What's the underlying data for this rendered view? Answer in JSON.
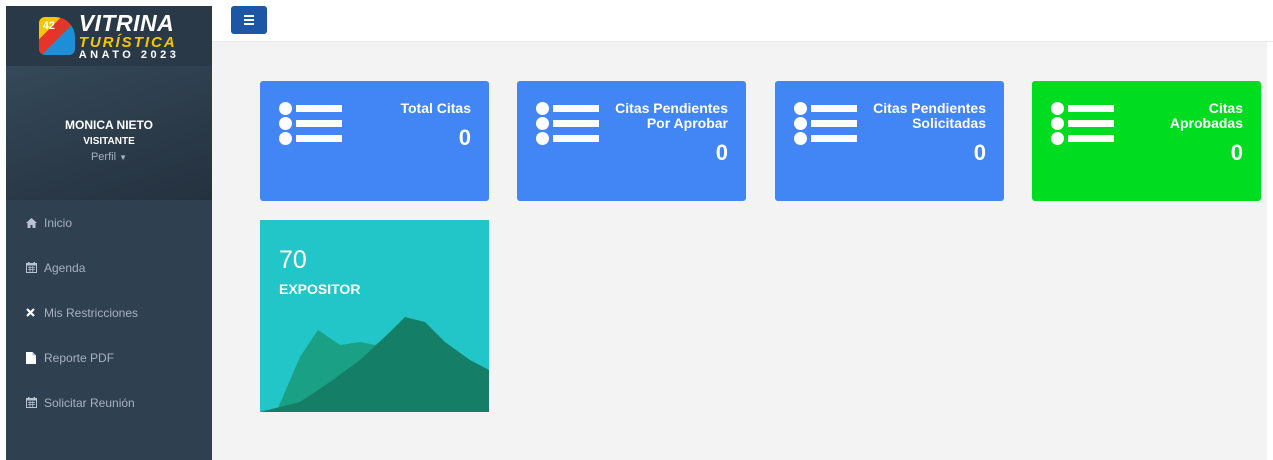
{
  "logo": {
    "number": "42",
    "line1": "VITRINA",
    "line2": "TURÍSTICA",
    "line3": "ANATO 2023"
  },
  "profile": {
    "name": "MONICA NIETO",
    "role": "VISITANTE",
    "link": "Perfil",
    "link_icon": "caret-down-icon"
  },
  "menu": [
    {
      "label": "Inicio",
      "icon": "home-icon"
    },
    {
      "label": "Agenda",
      "icon": "calendar-icon"
    },
    {
      "label": "Mis Restricciones",
      "icon": "close-icon"
    },
    {
      "label": "Reporte PDF",
      "icon": "file-icon"
    },
    {
      "label": "Solicitar Reunión",
      "icon": "calendar-icon"
    }
  ],
  "topbar": {
    "toggle_icon": "hamburger-icon",
    "toggle_color": "#1c56a4"
  },
  "cards": [
    {
      "title": "Total Citas",
      "value": "0",
      "icon": "list-icon",
      "color": "#4285f4"
    },
    {
      "title": "Citas Pendientes Por Aprobar",
      "value": "0",
      "icon": "list-icon",
      "color": "#4285f4"
    },
    {
      "title": "Citas Pendientes Solicitadas",
      "value": "0",
      "icon": "list-icon",
      "color": "#4285f4"
    },
    {
      "title": "Citas Aprobadas",
      "value": "0",
      "icon": "list-icon",
      "color": "#00dc1f"
    }
  ],
  "stat_card": {
    "value": "70",
    "label": "EXPOSITOR",
    "color": "#23c6c8"
  },
  "colors": {
    "sidebar": "#2f4050",
    "background": "#f3f3f4",
    "menu_text": "#a7b1c2"
  }
}
